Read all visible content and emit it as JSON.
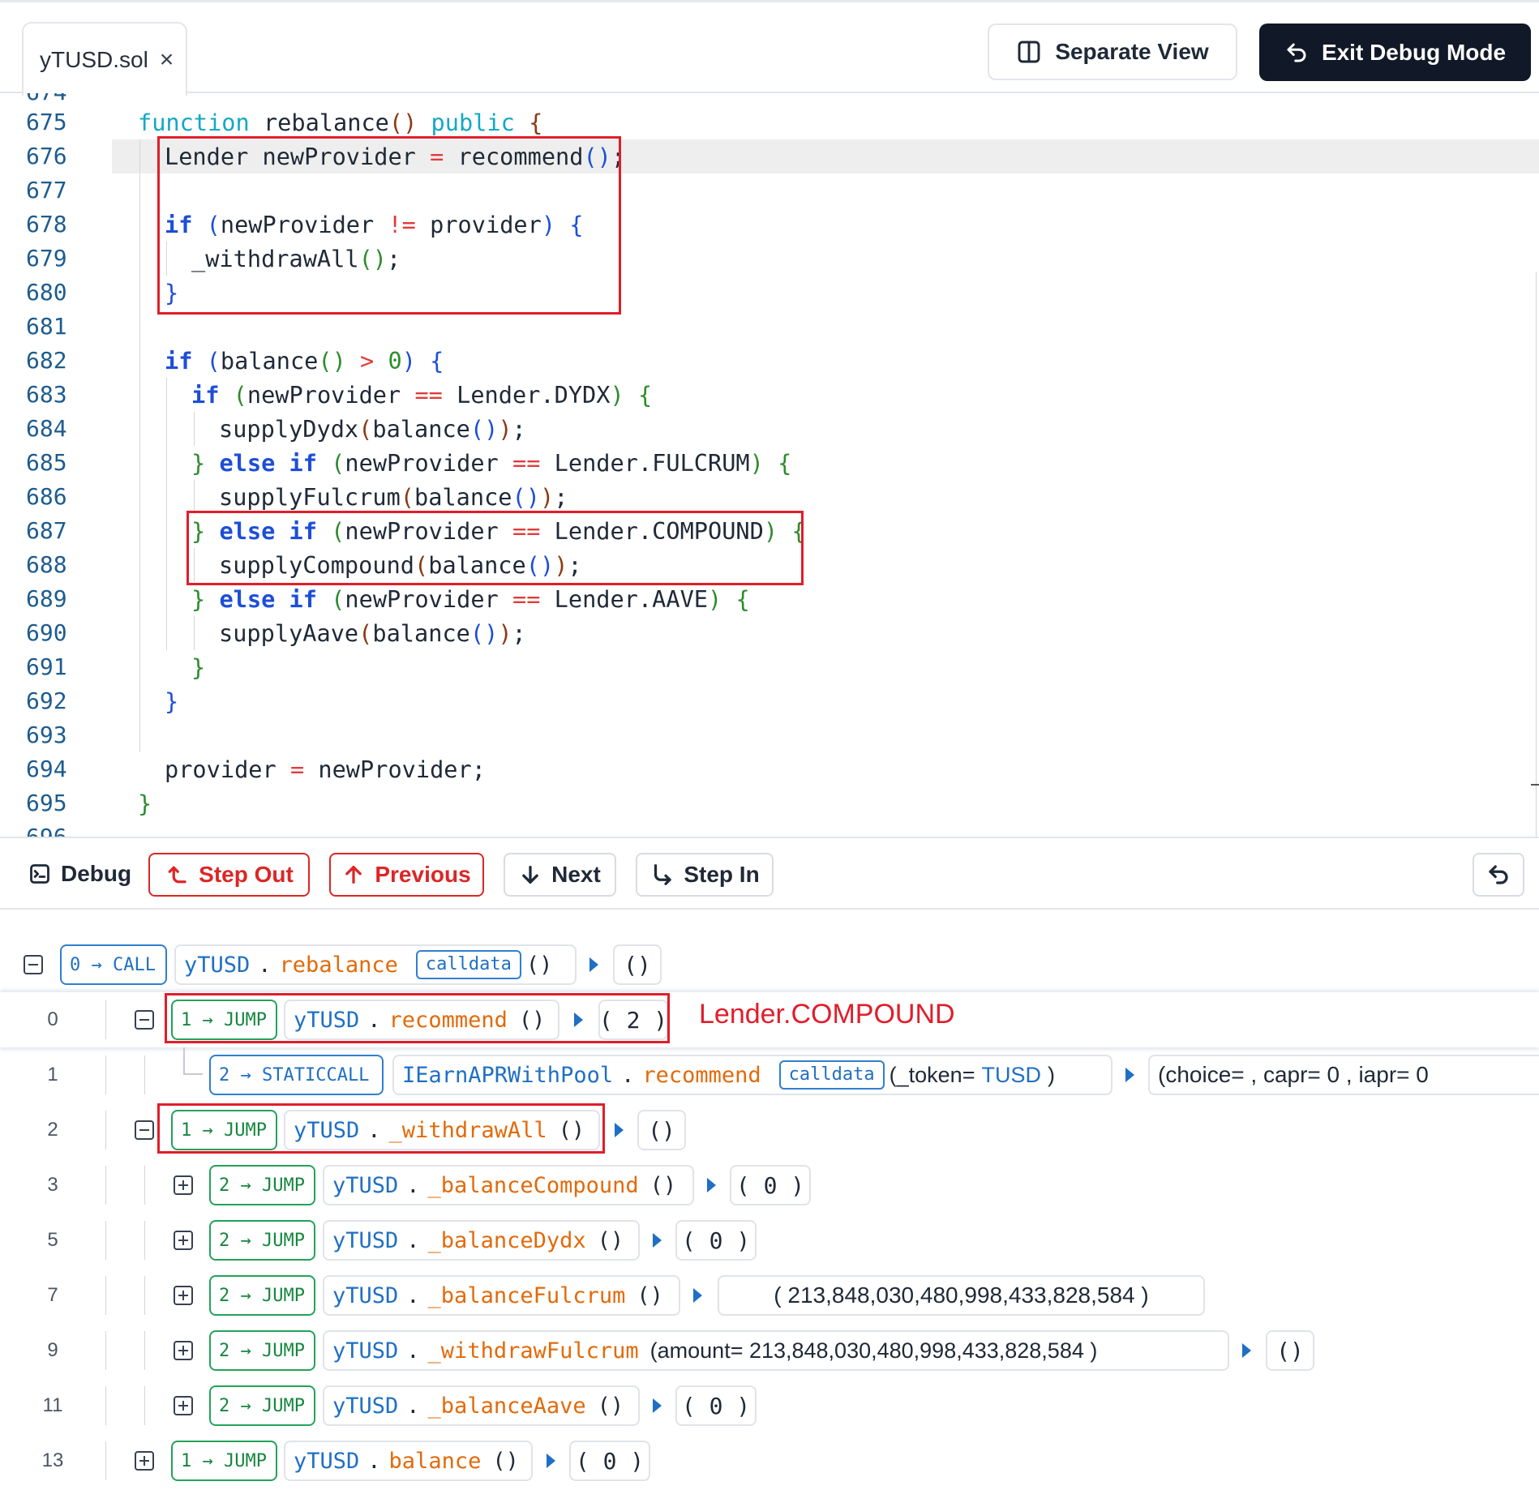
{
  "file_tab": {
    "name": "yTUSD.sol",
    "close": "×"
  },
  "header": {
    "separate_view": "Separate View",
    "exit_debug": "Exit Debug Mode"
  },
  "editor": {
    "line_numbers": [
      "675",
      "676",
      "677",
      "678",
      "679",
      "680",
      "681",
      "682",
      "683",
      "684",
      "685",
      "686",
      "687",
      "688",
      "689",
      "690",
      "691",
      "692",
      "693",
      "694",
      "695"
    ],
    "current_line": "676"
  },
  "debug_toolbar": {
    "title": "Debug",
    "step_out": "Step Out",
    "previous": "Previous",
    "next": "Next",
    "step_in": "Step In"
  },
  "annotation": "Lender.COMPOUND",
  "trace": {
    "root": {
      "op": "0 → CALL",
      "contract": "yTUSD",
      "method": "rebalance",
      "calldata": "calldata",
      "args": "()",
      "ret": "()"
    },
    "rows": [
      {
        "no": "0",
        "op": "1 → JUMP",
        "contract": "yTUSD",
        "method": "recommend",
        "args": "()",
        "ret": "( 2 )"
      },
      {
        "no": "1",
        "op": "2 → STATICCALL",
        "contract": "IEarnAPRWithPool",
        "method": "recommend",
        "calldata": "calldata",
        "args_open": "(_token=",
        "args_val": "TUSD",
        "args_close": ")",
        "ret": "(choice=   ,  capr= 0 ,  iapr= 0"
      },
      {
        "no": "2",
        "op": "1 → JUMP",
        "contract": "yTUSD",
        "method": "_withdrawAll",
        "args": "()",
        "ret": "()"
      },
      {
        "no": "3",
        "op": "2 → JUMP",
        "contract": "yTUSD",
        "method": "_balanceCompound",
        "args": "()",
        "ret": "( 0 )"
      },
      {
        "no": "5",
        "op": "2 → JUMP",
        "contract": "yTUSD",
        "method": "_balanceDydx",
        "args": "()",
        "ret": "( 0 )"
      },
      {
        "no": "7",
        "op": "2 → JUMP",
        "contract": "yTUSD",
        "method": "_balanceFulcrum",
        "args": "()",
        "ret": "( 213,848,030,480,998,433,828,584 )"
      },
      {
        "no": "9",
        "op": "2 → JUMP",
        "contract": "yTUSD",
        "method": "_withdrawFulcrum",
        "args": "(amount= 213,848,030,480,998,433,828,584 )",
        "ret": "()"
      },
      {
        "no": "11",
        "op": "2 → JUMP",
        "contract": "yTUSD",
        "method": "_balanceAave",
        "args": "()",
        "ret": "( 0 )"
      },
      {
        "no": "13",
        "op": "1 → JUMP",
        "contract": "yTUSD",
        "method": "balance",
        "args": "()",
        "ret": "( 0 )"
      }
    ]
  },
  "colors": {
    "annotation_red": "#e11d2a",
    "jump_green": "#16873f",
    "call_blue": "#1f6fc4",
    "method_orange": "#e26a0a"
  }
}
